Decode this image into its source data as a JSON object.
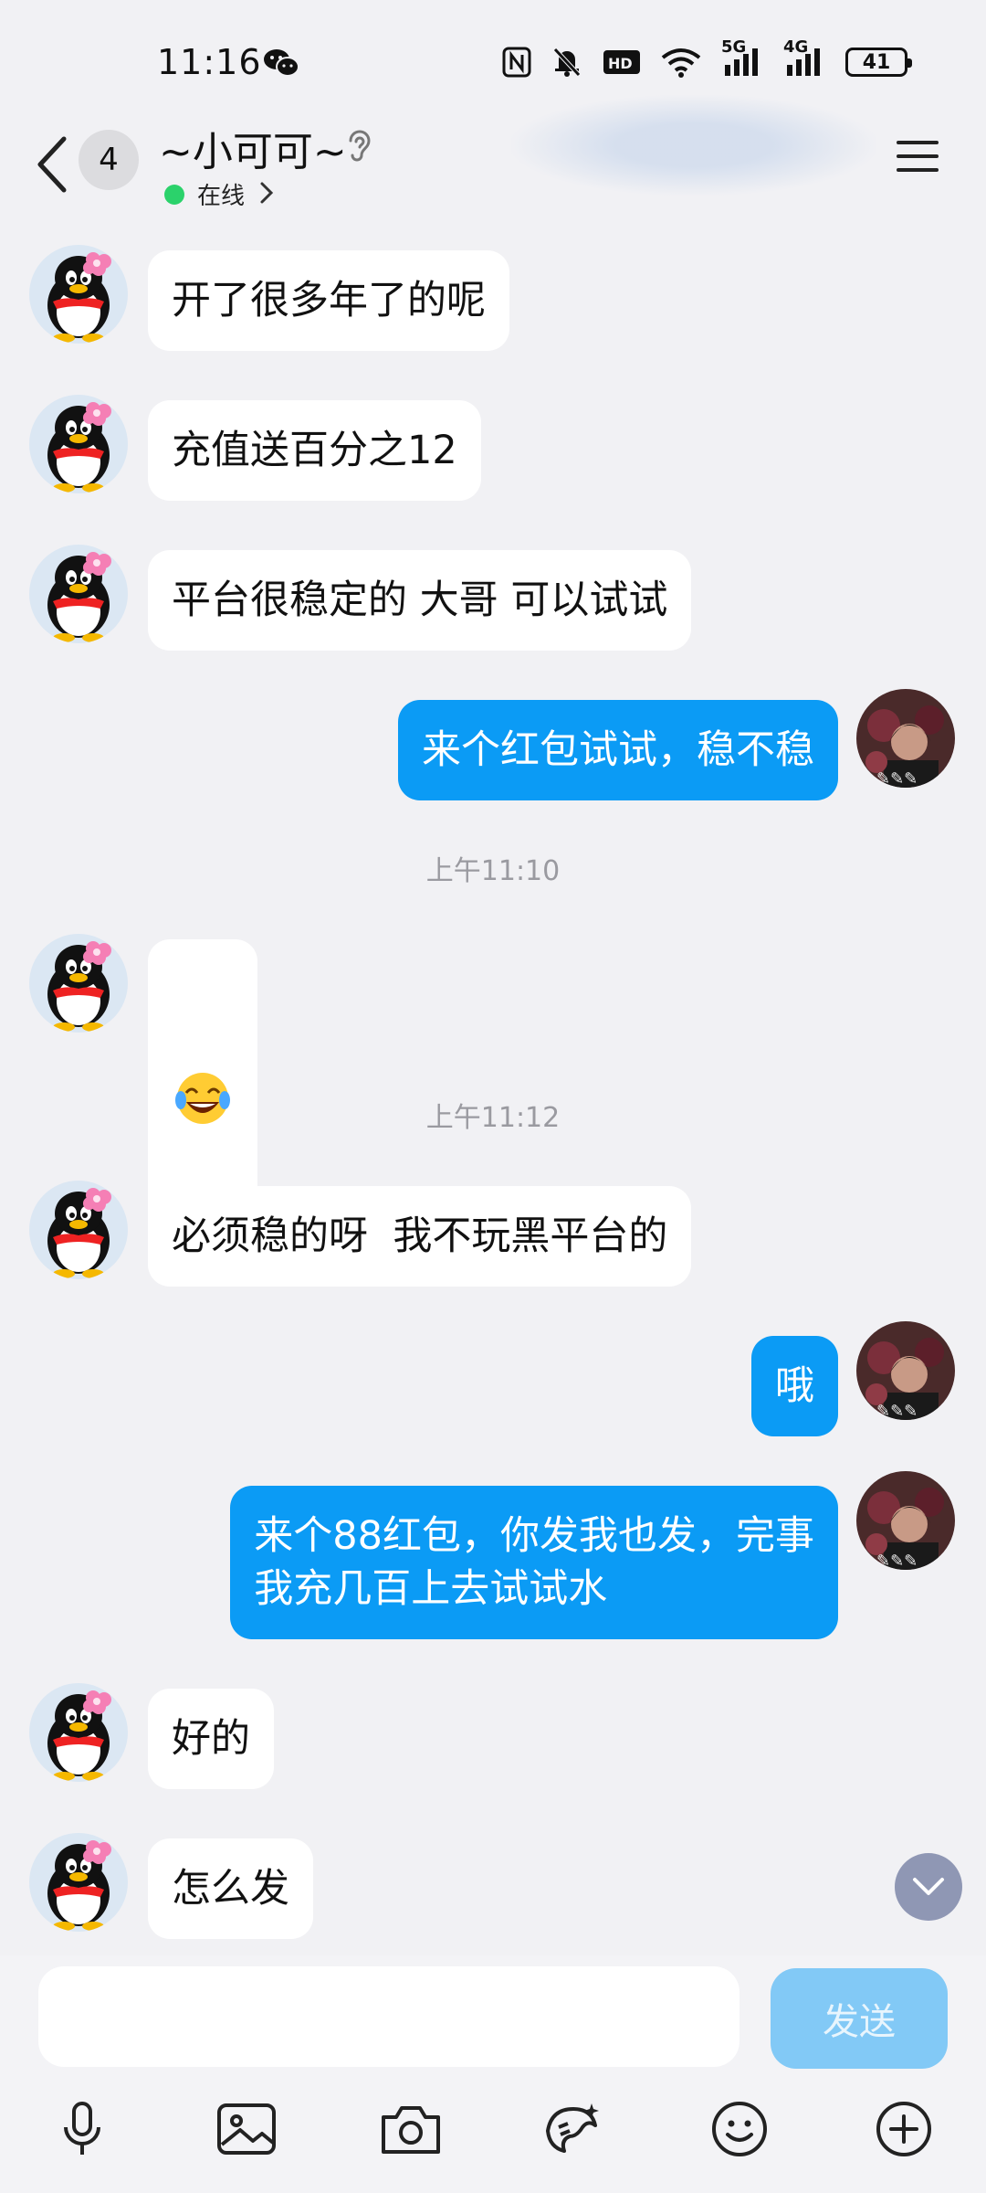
{
  "status_bar": {
    "time": "11:16",
    "network_5g": "5G",
    "network_4g": "4G",
    "battery": "41"
  },
  "header": {
    "unread_count": "4",
    "contact_name": "~小可可~",
    "presence": "在线"
  },
  "messages": [
    {
      "side": "in",
      "text": "开了很多年了的呢"
    },
    {
      "side": "in",
      "text": "充值送百分之12"
    },
    {
      "side": "in",
      "text": "平台很稳定的 大哥 可以试试"
    },
    {
      "side": "out",
      "text": "来个红包试试，稳不稳"
    },
    {
      "side": "time",
      "text": "上午11:10"
    },
    {
      "side": "in",
      "emoji": "tears-of-joy-emoji"
    },
    {
      "side": "time",
      "text": "上午11:12"
    },
    {
      "side": "in",
      "text": "必须稳的呀  我不玩黑平台的"
    },
    {
      "side": "out",
      "text": "哦"
    },
    {
      "side": "out",
      "text": "来个88红包，你发我也发，完事\n我充几百上去试试水"
    },
    {
      "side": "in",
      "text": "好的"
    },
    {
      "side": "in",
      "text": "怎么发"
    }
  ],
  "composer": {
    "input_value": "",
    "send_label": "发送"
  },
  "toolbar": {
    "icons": [
      "microphone-icon",
      "image-icon",
      "camera-icon",
      "paint-icon",
      "emoji-icon",
      "plus-icon"
    ]
  },
  "colors": {
    "outgoing_bubble": "#0b9bf5",
    "incoming_bubble": "#ffffff",
    "background": "#f1f1f4",
    "send_button_disabled": "#82c9f6",
    "online_dot": "#2bd26b"
  }
}
